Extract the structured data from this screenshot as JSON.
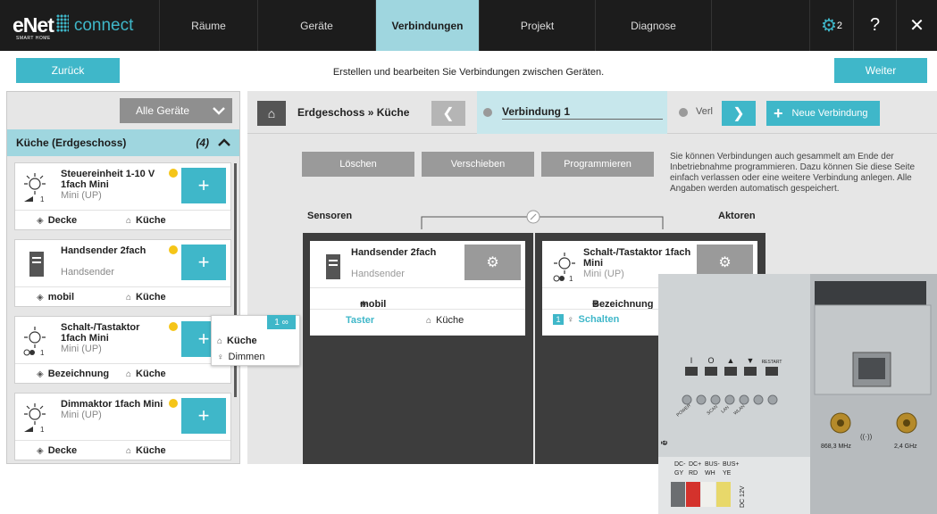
{
  "brand": {
    "logo": "eNet",
    "product": "connect",
    "sub": "SMART HOME"
  },
  "nav": {
    "tabs": [
      "Räume",
      "Geräte",
      "Verbindungen",
      "Projekt",
      "Diagnose"
    ],
    "active": "Verbindungen",
    "settings_badge": "2",
    "help_icon": "?",
    "close_icon": "✕"
  },
  "toolbar": {
    "back_label": "Zurück",
    "next_label": "Weiter",
    "subtitle": "Erstellen und bearbeiten Sie Verbindungen zwischen Geräten."
  },
  "sidebar": {
    "filter_value": "Alle Geräte",
    "room_title": "Küche (Erdgeschoss)",
    "room_count": "(4)",
    "devices": [
      {
        "name": "Steuereinheit 1-10 V 1fach Mini",
        "type": "Mini (UP)",
        "tag": "Decke",
        "room": "Küche",
        "icon": "dimmer-icon",
        "channel": "1"
      },
      {
        "name": "Handsender 2fach",
        "type": "Handsender",
        "tag": "mobil",
        "room": "Küche",
        "icon": "handheld-sender-icon"
      },
      {
        "name": "Schalt-/Tastaktor 1fach Mini",
        "type": "Mini (UP)",
        "tag": "Bezeichnung",
        "room": "Küche",
        "icon": "switch-actuator-icon",
        "channel": "1"
      },
      {
        "name": "Dimmaktor 1fach Mini",
        "type": "Mini (UP)",
        "tag": "Decke",
        "room": "Küche",
        "icon": "dimmer-icon",
        "channel": "1"
      }
    ],
    "popup": {
      "badge": "1",
      "room": "Küche",
      "function": "Dimmen"
    }
  },
  "connection": {
    "breadcrumb": "Erdgeschoss » Küche",
    "current_name": "Verbindung 1",
    "next_name": "Verl",
    "new_label": "Neue Verbindung",
    "actions": [
      "Löschen",
      "Verschieben",
      "Programmieren"
    ],
    "info": "Sie können Verbindungen auch gesammelt am Ende der Inbetriebnahme programmieren. Dazu können Sie diese Seite einfach verlassen oder eine weitere Verbindung anlegen. Alle Angaben werden automatisch gespeichert.",
    "sensors_label": "Sensoren",
    "actors_label": "Aktoren",
    "sensor": {
      "name": "Handsender 2fach",
      "type": "Handsender",
      "tag": "mobil",
      "function": "Taster",
      "room": "Küche"
    },
    "actor": {
      "name": "Schalt-/Tastaktor 1fach Mini",
      "type": "Mini (UP)",
      "channel": "1",
      "tag": "Bezeichnung",
      "function_badge": "1",
      "function": "Schalten"
    }
  },
  "device_photo": {
    "buttons": [
      "I",
      "O",
      "▲",
      "▼",
      "RESTART"
    ],
    "leds": [
      "POWER",
      "",
      "SCAN",
      "LAN",
      "WLAN",
      "",
      ""
    ],
    "freq1": "868,3 MHz",
    "freq2": "2,4 GHz",
    "terminals": [
      "DC-",
      "DC+",
      "BUS-",
      "BUS+"
    ],
    "terminal_colors": [
      "GY",
      "RD",
      "WH",
      "YE"
    ],
    "dc_label": "DC 12V",
    "brand_mark": "ē"
  },
  "colors": {
    "accent": "#3fb7c9",
    "accent_light": "#9fd6df",
    "status_dot": "#f5c518"
  }
}
